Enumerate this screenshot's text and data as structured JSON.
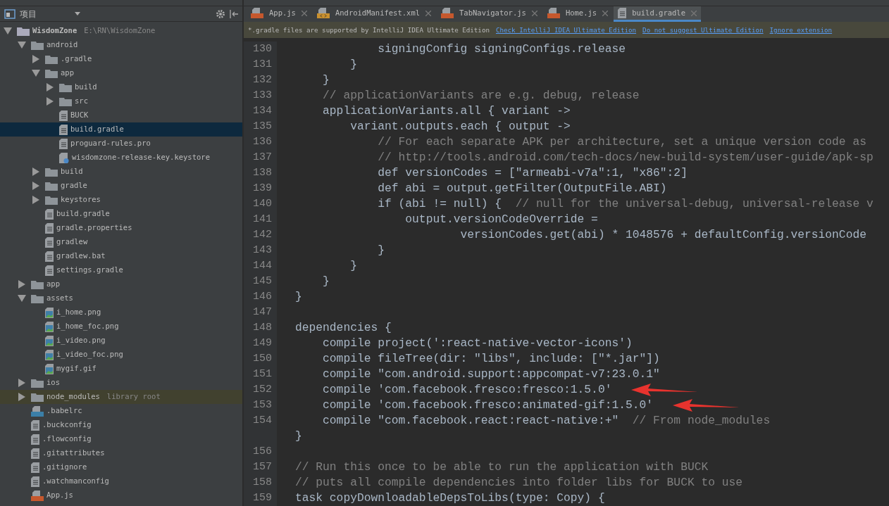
{
  "project_panel": {
    "title": "项目",
    "tree": [
      {
        "name": "WisdomZone",
        "hint": "E:\\RN\\WisdomZone",
        "kind": "module",
        "expanded": true,
        "selected": false,
        "highlighted": false,
        "children": [
          {
            "name": "android",
            "kind": "folder",
            "expanded": true,
            "selected": false,
            "highlighted": false,
            "children": [
              {
                "name": ".gradle",
                "kind": "folder",
                "expanded": false,
                "selected": false,
                "highlighted": false
              },
              {
                "name": "app",
                "kind": "folder",
                "expanded": true,
                "selected": false,
                "highlighted": false,
                "children": [
                  {
                    "name": "build",
                    "kind": "folder",
                    "expanded": false,
                    "selected": false,
                    "highlighted": false
                  },
                  {
                    "name": "src",
                    "kind": "folder",
                    "expanded": false,
                    "selected": false,
                    "highlighted": false
                  },
                  {
                    "name": "BUCK",
                    "kind": "file",
                    "selected": false,
                    "highlighted": false
                  },
                  {
                    "name": "build.gradle",
                    "kind": "file",
                    "selected": true,
                    "highlighted": false
                  },
                  {
                    "name": "proguard-rules.pro",
                    "kind": "file",
                    "selected": false,
                    "highlighted": false
                  },
                  {
                    "name": "wisdomzone-release-key.keystore",
                    "kind": "unknown",
                    "selected": false,
                    "highlighted": false
                  }
                ]
              },
              {
                "name": "build",
                "kind": "folder",
                "expanded": false,
                "selected": false,
                "highlighted": false
              },
              {
                "name": "gradle",
                "kind": "folder",
                "expanded": false,
                "selected": false,
                "highlighted": false
              },
              {
                "name": "keystores",
                "kind": "folder",
                "expanded": false,
                "selected": false,
                "highlighted": false
              },
              {
                "name": "build.gradle",
                "kind": "file",
                "selected": false,
                "highlighted": false
              },
              {
                "name": "gradle.properties",
                "kind": "file",
                "selected": false,
                "highlighted": false
              },
              {
                "name": "gradlew",
                "kind": "file",
                "selected": false,
                "highlighted": false
              },
              {
                "name": "gradlew.bat",
                "kind": "file",
                "selected": false,
                "highlighted": false
              },
              {
                "name": "settings.gradle",
                "kind": "file",
                "selected": false,
                "highlighted": false
              }
            ]
          },
          {
            "name": "app",
            "kind": "folder",
            "expanded": false,
            "selected": false,
            "highlighted": false
          },
          {
            "name": "assets",
            "kind": "folder",
            "expanded": true,
            "selected": false,
            "highlighted": false,
            "children": [
              {
                "name": "i_home.png",
                "kind": "image",
                "selected": false,
                "highlighted": false
              },
              {
                "name": "i_home_foc.png",
                "kind": "image",
                "selected": false,
                "highlighted": false
              },
              {
                "name": "i_video.png",
                "kind": "image",
                "selected": false,
                "highlighted": false
              },
              {
                "name": "i_video_foc.png",
                "kind": "image",
                "selected": false,
                "highlighted": false
              },
              {
                "name": "mygif.gif",
                "kind": "image",
                "selected": false,
                "highlighted": false
              }
            ]
          },
          {
            "name": "ios",
            "kind": "folder",
            "expanded": false,
            "selected": false,
            "highlighted": false
          },
          {
            "name": "node_modules",
            "hint": "library root",
            "kind": "folder",
            "expanded": false,
            "selected": false,
            "highlighted": true
          },
          {
            "name": ".babelrc",
            "kind": "json",
            "selected": false,
            "highlighted": false
          },
          {
            "name": ".buckconfig",
            "kind": "file",
            "selected": false,
            "highlighted": false
          },
          {
            "name": ".flowconfig",
            "kind": "file",
            "selected": false,
            "highlighted": false
          },
          {
            "name": ".gitattributes",
            "kind": "file",
            "selected": false,
            "highlighted": false
          },
          {
            "name": ".gitignore",
            "kind": "file",
            "selected": false,
            "highlighted": false
          },
          {
            "name": ".watchmanconfig",
            "kind": "file",
            "selected": false,
            "highlighted": false
          },
          {
            "name": "App.js",
            "kind": "js",
            "selected": false,
            "highlighted": false
          }
        ]
      }
    ]
  },
  "editor": {
    "tabs": [
      {
        "label": "App.js",
        "kind": "js",
        "selected": false
      },
      {
        "label": "AndroidManifest.xml",
        "kind": "xml",
        "selected": false
      },
      {
        "label": "TabNavigator.js",
        "kind": "js",
        "selected": false
      },
      {
        "label": "Home.js",
        "kind": "js",
        "selected": false
      },
      {
        "label": "build.gradle",
        "kind": "file",
        "selected": true
      }
    ],
    "notice": {
      "text": "*.gradle files are supported by IntelliJ IDEA Ultimate Edition",
      "links": [
        "Check IntelliJ IDEA Ultimate Edition",
        "Do not suggest Ultimate Edition",
        "Ignore extension"
      ]
    },
    "lines": [
      {
        "number": "130",
        "code": "            signingConfig signingConfigs.release",
        "marked": false
      },
      {
        "number": "131",
        "code": "        }",
        "marked": false
      },
      {
        "number": "132",
        "code": "    }",
        "marked": false
      },
      {
        "number": "133",
        "comment": "    // applicationVariants are e.g. debug, release",
        "marked": false
      },
      {
        "number": "134",
        "code": "    applicationVariants.all { variant ->",
        "marked": false
      },
      {
        "number": "135",
        "code": "        variant.outputs.each { output ->",
        "marked": false
      },
      {
        "number": "136",
        "comment": "            // For each separate APK per architecture, set a unique version code as",
        "marked": false
      },
      {
        "number": "137",
        "comment": "            // http://tools.android.com/tech-docs/new-build-system/user-guide/apk-sp",
        "marked": false
      },
      {
        "number": "138",
        "code": "            def versionCodes = [\"armeabi-v7a\":1, \"x86\":2]",
        "marked": false
      },
      {
        "number": "139",
        "code": "            def abi = output.getFilter(OutputFile.ABI)",
        "marked": false
      },
      {
        "number": "140",
        "code": "            if (abi != null) {  ",
        "comment": "// null for the universal-debug, universal-release v",
        "marked": false
      },
      {
        "number": "141",
        "code": "                output.versionCodeOverride =",
        "marked": false
      },
      {
        "number": "142",
        "code": "                        versionCodes.get(abi) * 1048576 + defaultConfig.versionCode",
        "marked": false
      },
      {
        "number": "143",
        "code": "            }",
        "marked": false
      },
      {
        "number": "144",
        "code": "        }",
        "marked": false
      },
      {
        "number": "145",
        "code": "    }",
        "marked": false
      },
      {
        "number": "146",
        "code": "}",
        "marked": false
      },
      {
        "number": "147",
        "marked": false
      },
      {
        "number": "148",
        "code": "dependencies {",
        "marked": false
      },
      {
        "number": "149",
        "code": "    compile project(':react-native-vector-icons')",
        "marked": false
      },
      {
        "number": "150",
        "code": "    compile fileTree(dir: \"libs\", include: [\"*.jar\"])",
        "marked": false
      },
      {
        "number": "151",
        "code": "    compile \"com.android.support:appcompat-v7:23.0.1\"",
        "marked": false
      },
      {
        "number": "152",
        "code": "    compile 'com.facebook.fresco:fresco:1.5.0'",
        "marked": true
      },
      {
        "number": "153",
        "code": "    compile 'com.facebook.fresco:animated-gif:1.5.0'",
        "marked": true
      },
      {
        "number": "154",
        "code": "    compile \"com.facebook.react:react-native:+\"  ",
        "comment": "// From node_modules",
        "marked": false
      },
      {
        "code": "}",
        "marked": false
      },
      {
        "number": "156",
        "marked": false
      },
      {
        "number": "157",
        "comment": "// Run this once to be able to run the application with BUCK",
        "marked": false
      },
      {
        "number": "158",
        "comment": "// puts all compile dependencies into folder libs for BUCK to use",
        "marked": false
      },
      {
        "number": "159",
        "code": "task copyDownloadableDepsToLibs(type: Copy) {",
        "marked": false
      }
    ]
  }
}
